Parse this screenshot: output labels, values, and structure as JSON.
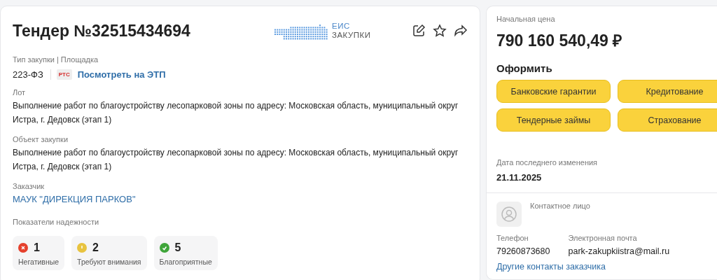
{
  "header": {
    "title": "Тендер №32515434694",
    "logo_line1": "ЕИС",
    "logo_line2": "ЗАКУПКИ"
  },
  "procurement": {
    "label": "Тип закупки | Площадка",
    "law": "223-ФЗ",
    "platform_badge": "РТС",
    "platform_link": "Посмотреть на ЭТП"
  },
  "fields": [
    {
      "label": "Лот",
      "value": "Выполнение работ по благоустройству лесопарковой зоны по адресу: Московская область, муниципальный округ Истра, г. Дедовск (этап 1)",
      "kind": "text"
    },
    {
      "label": "Объект закупки",
      "value": "Выполнение работ по благоустройству лесопарковой зоны по адресу: Московская область, муниципальный округ Истра, г. Дедовск (этап 1)",
      "kind": "text"
    },
    {
      "label": "Заказчик",
      "value": "МАУК \"ДИРЕКЦИЯ ПАРКОВ\"",
      "kind": "link"
    }
  ],
  "reliability": {
    "label": "Показатели надежности",
    "items": [
      {
        "kind": "negative",
        "count": "1",
        "label": "Негативные"
      },
      {
        "kind": "warning",
        "count": "2",
        "label": "Требуют внимания"
      },
      {
        "kind": "positive",
        "count": "5",
        "label": "Благоприятные"
      }
    ]
  },
  "price": {
    "label": "Начальная цена",
    "value": "790 160 540,49 ₽"
  },
  "services": {
    "title": "Оформить",
    "buttons": [
      "Банковские гарантии",
      "Кредитование",
      "Тендерные займы",
      "Страхование"
    ]
  },
  "last_change": {
    "label": "Дата последнего изменения",
    "value": "21.11.2025"
  },
  "contact": {
    "label": "Контактное лицо",
    "phone_label": "Телефон",
    "phone": "79260873680",
    "email_label": "Электронная почта",
    "email": "park-zakupkiistra@mail.ru",
    "other_link": "Другие контакты заказчика"
  }
}
